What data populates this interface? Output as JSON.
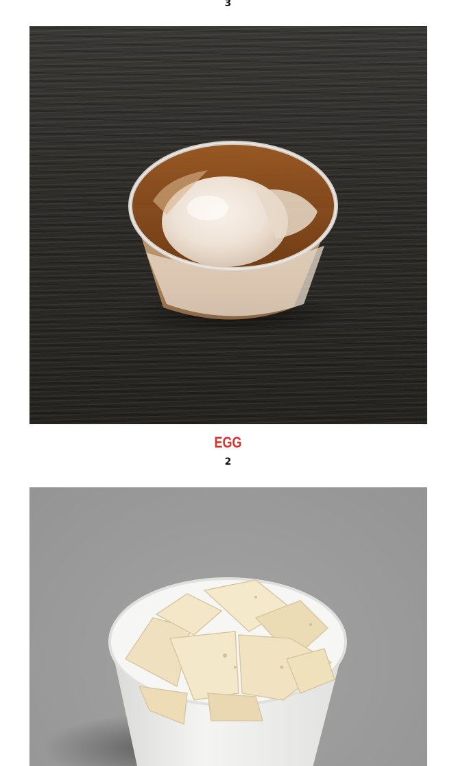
{
  "menu_items": [
    {
      "name": "",
      "price": "3"
    },
    {
      "name": "EGG",
      "price": "2",
      "image": "soft-boiled-egg-in-broth-cup"
    },
    {
      "name": "",
      "price": "",
      "image": "tofu-cubes-in-paper-cup"
    }
  ],
  "colors": {
    "item_name": "#d8322c",
    "price": "#111111",
    "background": "#ffffff"
  }
}
